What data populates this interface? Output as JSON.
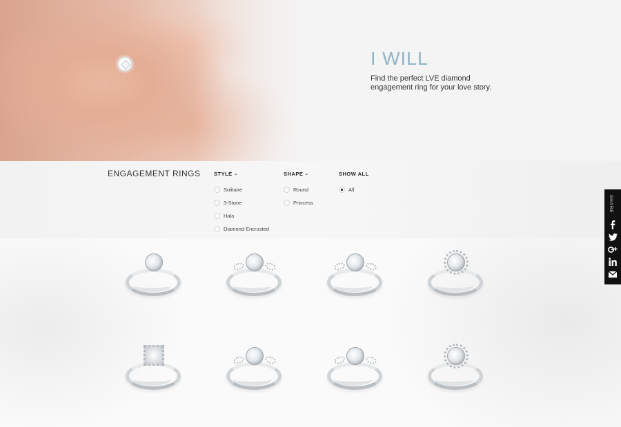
{
  "hero": {
    "title": "I WILL",
    "text": "Find the perfect LVE diamond engagement ring for your love story."
  },
  "filters": {
    "section_title": "ENGAGEMENT RINGS",
    "style": {
      "label": "STYLE",
      "options": [
        "Solitaire",
        "3-Stone",
        "Halo",
        "Diamond Encrusted"
      ]
    },
    "shape": {
      "label": "SHAPE",
      "options": [
        "Round",
        "Princess"
      ]
    },
    "show_all": {
      "label": "SHOW ALL",
      "options": [
        "All"
      ],
      "selected": "All"
    }
  },
  "products": [
    {
      "style": "solitaire",
      "icon": "engagement-ring-image"
    },
    {
      "style": "side-stones",
      "icon": "engagement-ring-image"
    },
    {
      "style": "side-stones",
      "icon": "engagement-ring-image"
    },
    {
      "style": "halo",
      "icon": "engagement-ring-image"
    },
    {
      "style": "square-halo",
      "icon": "engagement-ring-image"
    },
    {
      "style": "side-stones",
      "icon": "engagement-ring-image"
    },
    {
      "style": "side-stones",
      "icon": "engagement-ring-image"
    },
    {
      "style": "halo",
      "icon": "engagement-ring-image"
    }
  ],
  "share": {
    "label": "SHARE",
    "buttons": [
      "facebook-icon",
      "twitter-icon",
      "google-plus-icon",
      "linkedin-icon",
      "mail-icon"
    ]
  },
  "colors": {
    "hero_title": "#8fb3c6",
    "share_bar": "#111111"
  }
}
